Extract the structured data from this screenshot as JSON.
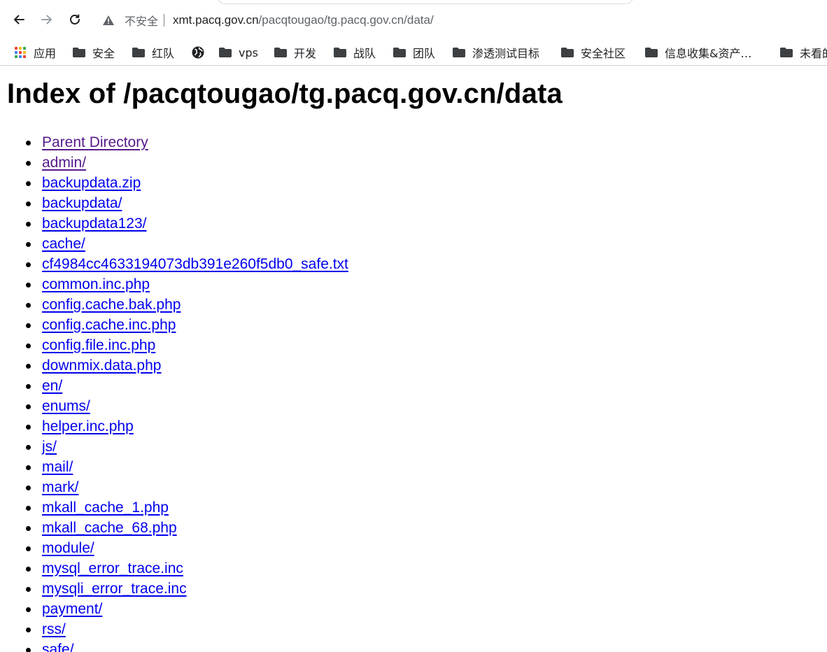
{
  "browser": {
    "security_label": "不安全",
    "url_host": "xmt.pacq.gov.cn",
    "url_path": "/pacqtougao/tg.pacq.gov.cn/data/"
  },
  "bookmarks": [
    {
      "label": "应用",
      "icon": "apps-grid-icon"
    },
    {
      "label": "安全",
      "icon": "folder-icon"
    },
    {
      "label": "红队",
      "icon": "folder-icon"
    },
    {
      "label": "",
      "icon": "globe-icon"
    },
    {
      "label": "vps",
      "icon": "folder-icon"
    },
    {
      "label": "开发",
      "icon": "folder-icon"
    },
    {
      "label": "战队",
      "icon": "folder-icon"
    },
    {
      "label": "团队",
      "icon": "folder-icon"
    },
    {
      "label": "渗透测试目标",
      "icon": "folder-icon"
    },
    {
      "label": "安全社区",
      "icon": "folder-icon"
    },
    {
      "label": "信息收集&资产…",
      "icon": "folder-icon"
    },
    {
      "label": "未看的",
      "icon": "folder-icon"
    }
  ],
  "page": {
    "title": "Index of /pacqtougao/tg.pacq.gov.cn/data",
    "entries": [
      {
        "name": "Parent Directory",
        "visited": true
      },
      {
        "name": "admin/",
        "visited": true
      },
      {
        "name": "backupdata.zip",
        "visited": false
      },
      {
        "name": "backupdata/",
        "visited": false
      },
      {
        "name": "backupdata123/",
        "visited": false
      },
      {
        "name": "cache/",
        "visited": false
      },
      {
        "name": "cf4984cc4633194073db391e260f5db0_safe.txt",
        "visited": false
      },
      {
        "name": "common.inc.php",
        "visited": false
      },
      {
        "name": "config.cache.bak.php",
        "visited": false
      },
      {
        "name": "config.cache.inc.php",
        "visited": false
      },
      {
        "name": "config.file.inc.php",
        "visited": false
      },
      {
        "name": "downmix.data.php",
        "visited": false
      },
      {
        "name": "en/",
        "visited": false
      },
      {
        "name": "enums/",
        "visited": false
      },
      {
        "name": "helper.inc.php",
        "visited": false
      },
      {
        "name": "js/",
        "visited": false
      },
      {
        "name": "mail/",
        "visited": false
      },
      {
        "name": "mark/",
        "visited": false
      },
      {
        "name": "mkall_cache_1.php",
        "visited": false
      },
      {
        "name": "mkall_cache_68.php",
        "visited": false
      },
      {
        "name": "module/",
        "visited": false
      },
      {
        "name": "mysql_error_trace.inc",
        "visited": false
      },
      {
        "name": "mysqli_error_trace.inc",
        "visited": false
      },
      {
        "name": "payment/",
        "visited": false
      },
      {
        "name": "rss/",
        "visited": false
      },
      {
        "name": "safe/",
        "visited": false
      }
    ]
  },
  "colors": {
    "link": "#0000ee",
    "visited_link": "#551a8b",
    "apps_grid": [
      "#ea4335",
      "#fbbc04",
      "#34a853",
      "#4285f4",
      "#ea4335",
      "#fbbc04",
      "#34a853",
      "#4285f4",
      "#ea4335"
    ]
  }
}
